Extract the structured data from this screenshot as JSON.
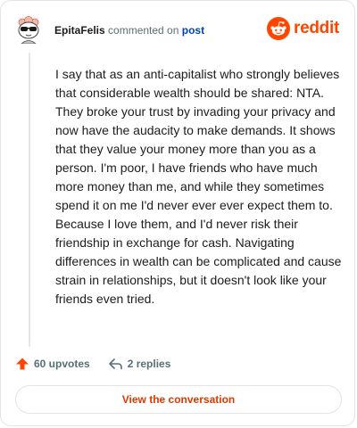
{
  "header": {
    "username": "EpitaFelis",
    "verb": "commented on",
    "post_link": "post",
    "brand": "reddit"
  },
  "comment": {
    "text": "I say that as an anti-capitalist who strongly believes that considerable wealth should be shared: NTA. They broke your trust by invading your privacy and now have the audacity to make demands. It shows that they value your money more than you as a person. I'm poor, I have friends who have much more money than me, and while they sometimes spend it on me I'd never ever ever expect them to. Because I love them, and I'd never risk their friendship in exchange for cash. Navigating differences in wealth can be complicated and cause strain in relationships, but it doesn't look like your friends even tried."
  },
  "actions": {
    "upvotes": "60 upvotes",
    "replies": "2 replies"
  },
  "cta": {
    "label": "View the conversation"
  },
  "colors": {
    "brand": "#ff4500",
    "link": "#0045ac",
    "cta": "#d93a00",
    "muted": "#576f76"
  },
  "icons": {
    "avatar": "snoo-avatar-sunglasses",
    "logo": "reddit-snoo-logo",
    "upvote": "upvote-arrow-icon",
    "reply": "reply-arrow-icon"
  }
}
